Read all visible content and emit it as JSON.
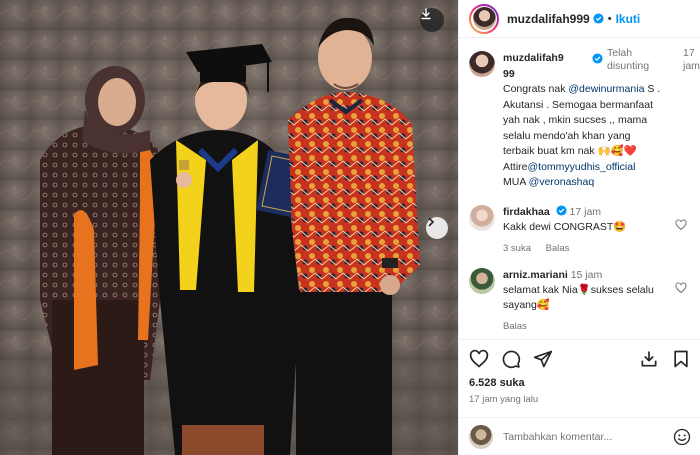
{
  "post": {
    "username": "muzdalifah999",
    "separator": "•",
    "follow_label": "Ikuti"
  },
  "caption": {
    "username_line1": "muzdalifah9",
    "username_line2": "99",
    "edited_line1": "Telah",
    "edited_line2": "disunting",
    "time_line1": "17",
    "time_line2": "jam",
    "text_1": "Congrats nak ",
    "mention_1": "@dewinurmania",
    "text_2": " S . Akutansi . Semogaa bermanfaat yah nak , mkin sucses ,, mama selalu mendo'ah khan yang terbaik buat km nak ",
    "emojis": "🙌🥰❤️",
    "attire_label": "Attire",
    "attire_mention": "@tommyyudhis_official",
    "mua_label": "MUA ",
    "mua_mention": "@veronashaq"
  },
  "comments": [
    {
      "username": "firdakhaa",
      "time": "17 jam",
      "text": "Kakk dewi CONGRAST",
      "emoji": "🤩",
      "likes": "3 suka",
      "reply": "Balas"
    },
    {
      "username": "arniz.mariani",
      "time": "15 jam",
      "text_1": "selamat kak Nia",
      "emoji_1": "🌹",
      "text_2": "sukses selalu sayang",
      "emoji_2": "🥰",
      "reply": "Balas"
    }
  ],
  "stats": {
    "likes": "6.528 suka",
    "date": "17 jam yang lalu"
  },
  "composer": {
    "placeholder": "Tambahkan komentar..."
  },
  "colors": {
    "accent": "#0095f6",
    "verified": "#0095f6",
    "gown": "#111111",
    "stole": "#f2d21b",
    "kebaya": "#3a2320",
    "sash": "#e8731e",
    "batik_red": "#c8331f",
    "backdrop": "#6f645d"
  },
  "icons": {
    "download": "download-icon",
    "next": "chevron-right-icon",
    "like": "heart-icon",
    "comment": "comment-icon",
    "share": "send-icon",
    "repost": "repost-icon",
    "save": "bookmark-icon",
    "emoji": "emoji-icon"
  }
}
